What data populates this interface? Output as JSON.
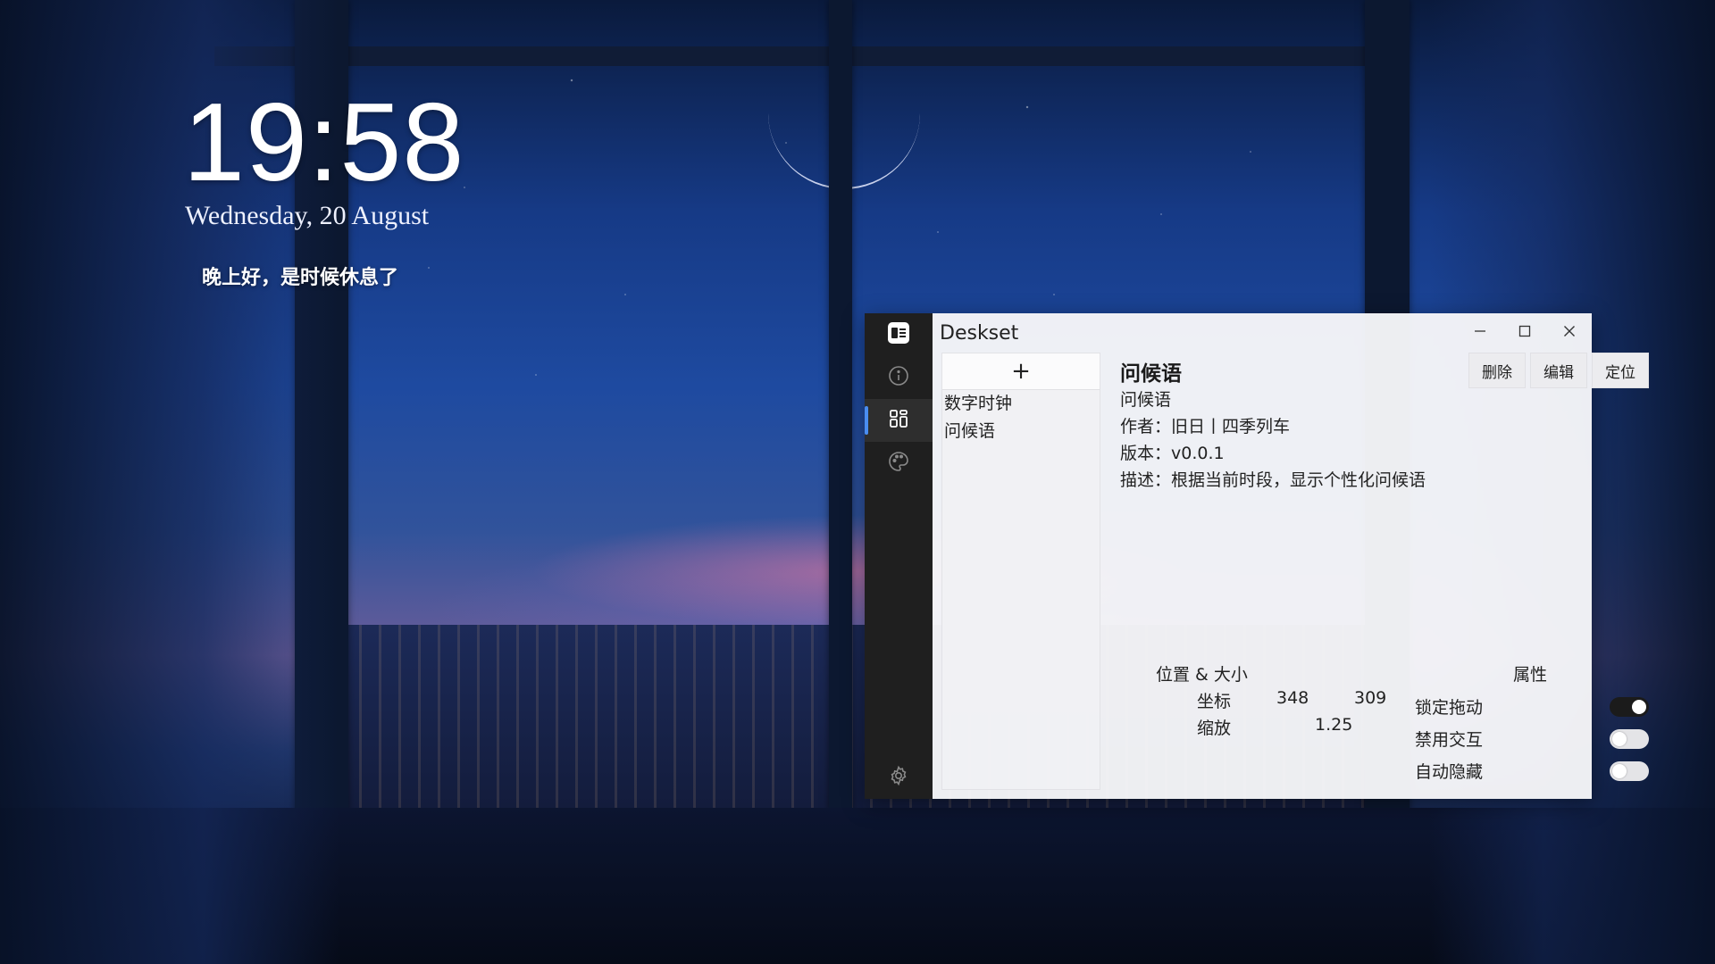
{
  "desktop": {
    "clock": {
      "time": "19:58",
      "date": "Wednesday, 20 August"
    },
    "greeting": "晚上好，是时候休息了"
  },
  "window": {
    "title": "Deskset",
    "sidebar": [
      {
        "icon": "app-logo-icon",
        "active": false
      },
      {
        "icon": "info-icon",
        "active": false
      },
      {
        "icon": "widgets-grid-icon",
        "active": true
      },
      {
        "icon": "palette-icon",
        "active": false
      },
      {
        "icon": "gear-icon",
        "active": false
      }
    ],
    "controls": {
      "minimize": "minimize-icon",
      "maximize": "maximize-icon",
      "close": "close-icon"
    },
    "list": {
      "add_label": "+",
      "items": [
        "数字时钟",
        "问候语"
      ]
    },
    "detail": {
      "title": "问候语",
      "name": "问候语",
      "author": "作者：旧日丨四季列车",
      "version": "版本：v0.0.1",
      "description": "描述：根据当前时段，显示个性化问候语"
    },
    "actions": {
      "delete": "删除",
      "edit": "编辑",
      "locate": "定位"
    },
    "position_size": {
      "heading": "位置 & 大小",
      "coord_label": "坐标",
      "x": "348",
      "y": "309",
      "scale_label": "缩放",
      "scale": "1.25"
    },
    "properties": {
      "heading": "属性",
      "items": [
        {
          "label": "锁定拖动",
          "enabled": true
        },
        {
          "label": "禁用交互",
          "enabled": false
        },
        {
          "label": "自动隐藏",
          "enabled": false
        }
      ]
    }
  }
}
